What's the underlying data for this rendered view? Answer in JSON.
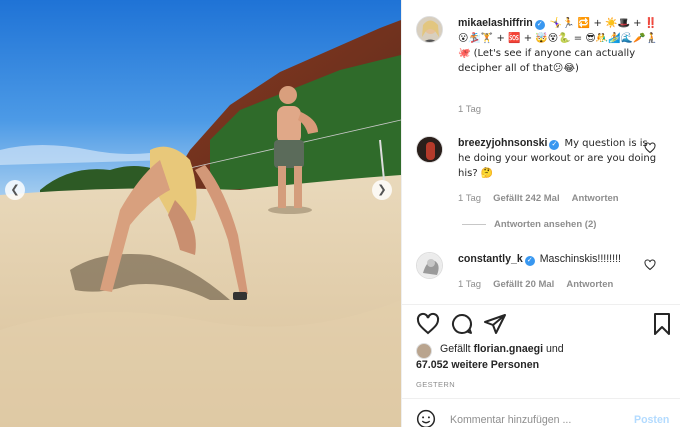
{
  "post": {
    "prev_icon": "chevron-left-icon",
    "next_icon": "chevron-right-icon"
  },
  "caption": {
    "username": "mikaelashiffrin",
    "text": "🤸‍♀️🏃 🔁 + ☀️🎩 + ‼️😮🏂🏋️ + 🆘 + 🤯😵🐍 = 😎🤼‍♂️🏄🌊🥕🧎🐙 (Let's see if anyone can actually decipher all of that😕😂)",
    "time": "1 Tag"
  },
  "comments": [
    {
      "username": "breezyjohnsonski",
      "text": "My question is is he doing your workout or are you doing his? 🤔",
      "time": "1 Tag",
      "likes": "Gefällt 242 Mal",
      "reply": "Antworten",
      "view_replies": "Antworten ansehen (2)"
    },
    {
      "username": "constantly_k",
      "text": "Maschinskis!!!!!!!!",
      "time": "1 Tag",
      "likes": "Gefällt 20 Mal",
      "reply": "Antworten"
    }
  ],
  "likes": {
    "prefix": "Gefällt",
    "user": "florian.gnaegi",
    "suffix": "und",
    "others": "67.052 weitere Personen"
  },
  "posted_date": "GESTERN",
  "add_comment": {
    "placeholder": "Kommentar hinzufügen ...",
    "post_label": "Posten"
  },
  "colors": {
    "verified": "#3897f0",
    "post_disabled": "#b3dbff",
    "meta_grey": "#8e8e8e"
  }
}
